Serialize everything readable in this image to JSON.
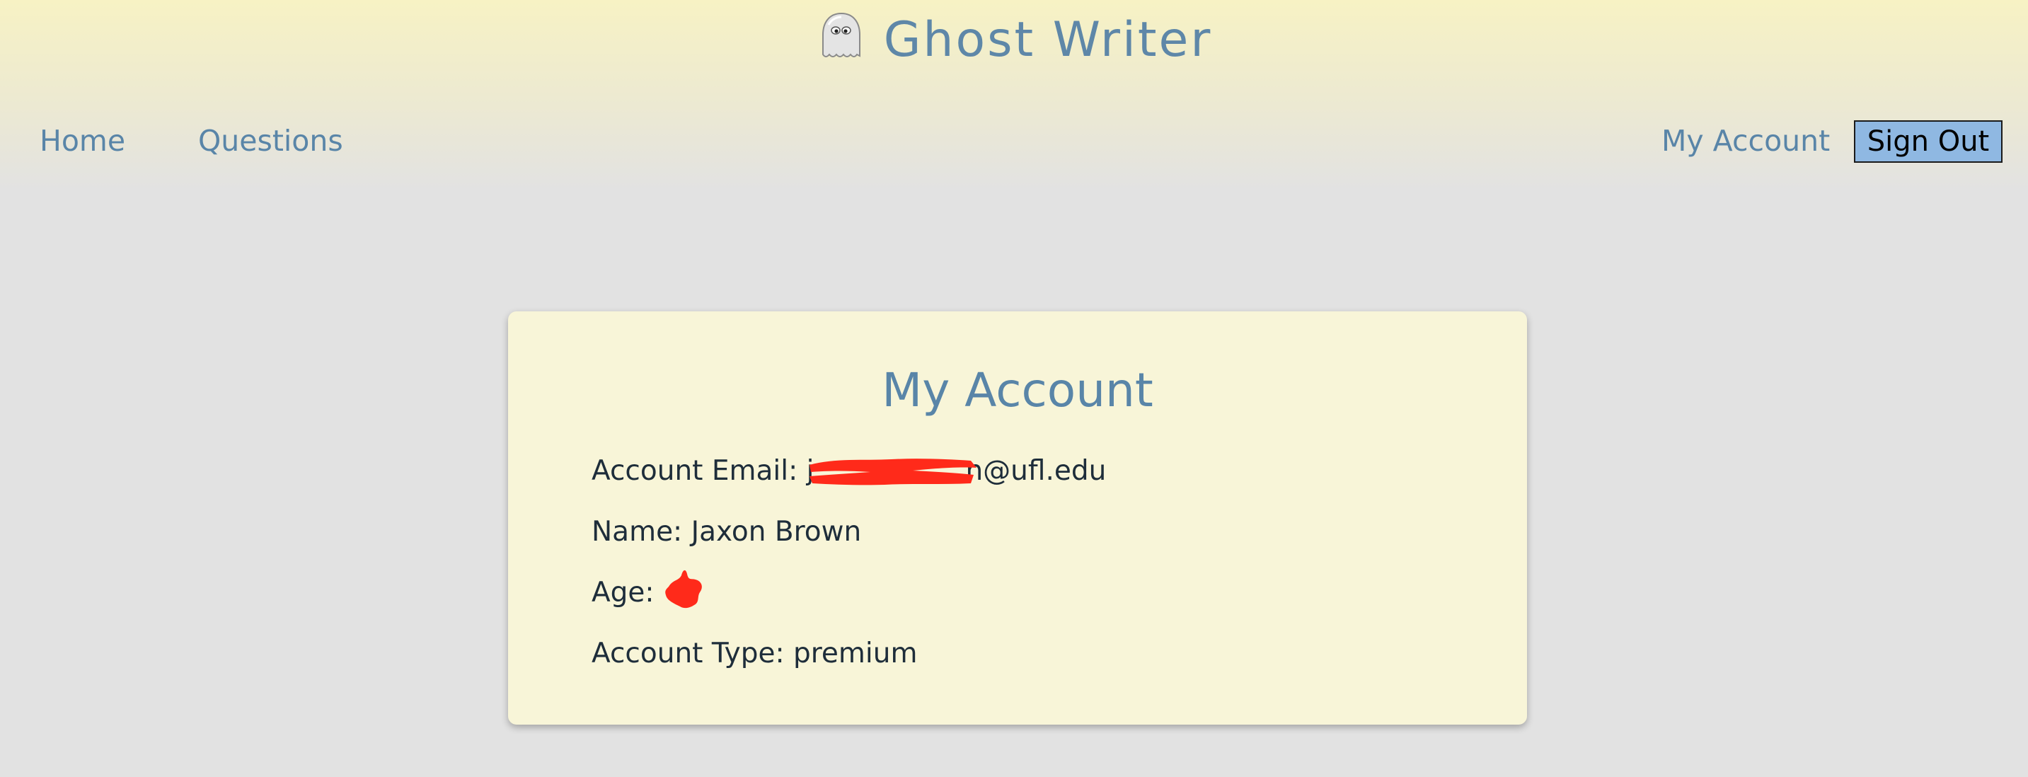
{
  "header": {
    "brand_name": "Ghost Writer",
    "logo_icon": "ghost-icon"
  },
  "nav": {
    "home": "Home",
    "questions": "Questions",
    "my_account": "My Account",
    "sign_out": "Sign Out"
  },
  "account": {
    "title": "My Account",
    "email_label": "Account Email:",
    "email_value_prefix": "j",
    "email_value_suffix": "n@ufl.edu",
    "name_label": "Name:",
    "name_value": "Jaxon Brown",
    "age_label": "Age:",
    "type_label": "Account Type:",
    "type_value": "premium"
  },
  "colors": {
    "accent": "#5985a8",
    "button": "#8fb8e2",
    "card": "#f8f5d8",
    "text": "#1e2d3a",
    "redaction": "#ff2a1a"
  }
}
